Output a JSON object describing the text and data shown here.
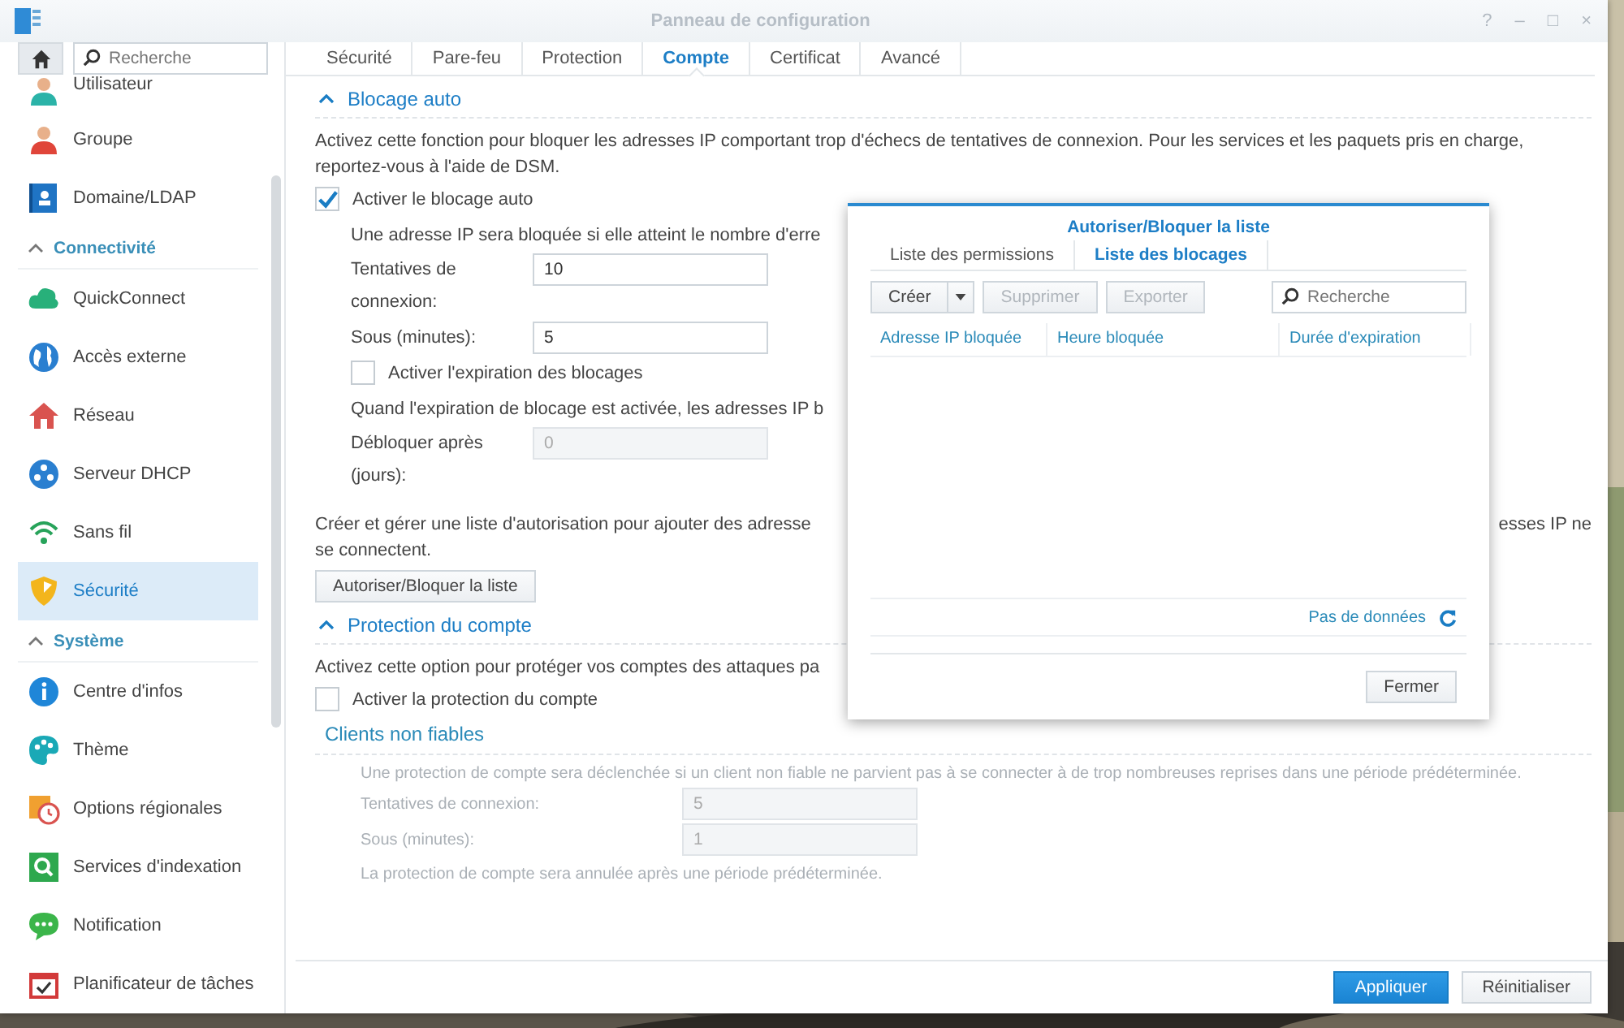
{
  "window": {
    "title": "Panneau de configuration",
    "controls": [
      "?",
      "–",
      "□",
      "×"
    ]
  },
  "sidebar": {
    "search": {
      "placeholder": "Recherche"
    },
    "items": [
      {
        "kind": "item",
        "label": "Utilisateur",
        "selected": false
      },
      {
        "kind": "item",
        "label": "Groupe",
        "selected": false
      },
      {
        "kind": "item",
        "label": "Domaine/LDAP",
        "selected": false
      },
      {
        "kind": "section",
        "label": "Connectivité"
      },
      {
        "kind": "item",
        "label": "QuickConnect",
        "selected": false
      },
      {
        "kind": "item",
        "label": "Accès externe",
        "selected": false
      },
      {
        "kind": "item",
        "label": "Réseau",
        "selected": false
      },
      {
        "kind": "item",
        "label": "Serveur DHCP",
        "selected": false
      },
      {
        "kind": "item",
        "label": "Sans fil",
        "selected": false
      },
      {
        "kind": "item",
        "label": "Sécurité",
        "selected": true
      },
      {
        "kind": "section",
        "label": "Système"
      },
      {
        "kind": "item",
        "label": "Centre d'infos",
        "selected": false
      },
      {
        "kind": "item",
        "label": "Thème",
        "selected": false
      },
      {
        "kind": "item",
        "label": "Options régionales",
        "selected": false
      },
      {
        "kind": "item",
        "label": "Services d'indexation",
        "selected": false
      },
      {
        "kind": "item",
        "label": "Notification",
        "selected": false
      },
      {
        "kind": "item",
        "label": "Planificateur de tâches",
        "selected": false
      }
    ]
  },
  "tabs": [
    {
      "label": "Sécurité",
      "selected": false
    },
    {
      "label": "Pare-feu",
      "selected": false
    },
    {
      "label": "Protection",
      "selected": false
    },
    {
      "label": "Compte",
      "selected": true
    },
    {
      "label": "Certificat",
      "selected": false
    },
    {
      "label": "Avancé",
      "selected": false
    }
  ],
  "auto_block": {
    "title": "Blocage auto",
    "description": "Activez cette fonction pour bloquer les adresses IP comportant trop d'échecs de tentatives de connexion. Pour les services et les paquets pris en charge, reportez-vous à l'aide de DSM.",
    "enable": {
      "label": "Activer le blocage auto",
      "checked": true
    },
    "hint": "Une adresse IP sera bloquée si elle atteint le nombre d'erre",
    "fields": [
      {
        "label": "Tentatives de connexion:",
        "value": "10",
        "disabled": false
      },
      {
        "label": "Sous (minutes):",
        "value": "5",
        "disabled": false
      }
    ],
    "expiration": {
      "label": "Activer l'expiration des blocages",
      "checked": false
    },
    "expiration_hint": "Quand l'expiration de blocage est activée, les adresses IP b",
    "unblock_field": {
      "label": "Débloquer après (jours):",
      "value": "0",
      "disabled": true
    },
    "list_text": {
      "left": "Créer et gérer une liste d'autorisation pour ajouter des adresse",
      "right": "esses IP ne",
      "end": "se connectent."
    },
    "list_button": "Autoriser/Bloquer la liste"
  },
  "account_protection": {
    "title": "Protection du compte",
    "description": "Activez cette option pour protéger vos comptes des attaques pa",
    "enable": {
      "label": "Activer la protection du compte",
      "checked": false
    },
    "subsection": "Clients non fiables",
    "hint": "Une protection de compte sera déclenchée si un client non fiable ne parvient pas à se connecter à de trop nombreuses reprises dans une période prédéterminée.",
    "fields": [
      {
        "label": "Tentatives de connexion:",
        "value": "5",
        "disabled": true
      },
      {
        "label": "Sous (minutes):",
        "value": "1",
        "disabled": true
      }
    ],
    "cancel_hint": "La protection de compte sera annulée après une période prédéterminée."
  },
  "footer": {
    "buttons": [
      {
        "label": "Appliquer",
        "kind": "primary"
      },
      {
        "label": "Réinitialiser",
        "kind": "default"
      }
    ]
  },
  "dialog": {
    "title": "Autoriser/Bloquer la liste",
    "tabs": [
      {
        "label": "Liste des permissions",
        "selected": false
      },
      {
        "label": "Liste des blocages",
        "selected": true
      }
    ],
    "toolbar": [
      {
        "label": "Créer",
        "disabled": false,
        "kind": "split"
      },
      {
        "label": "Supprimer",
        "disabled": true,
        "kind": "button"
      },
      {
        "label": "Exporter",
        "disabled": true,
        "kind": "button"
      }
    ],
    "search": {
      "placeholder": "Recherche"
    },
    "columns": [
      "Adresse IP bloquée",
      "Heure bloquée",
      "Durée d'expiration"
    ],
    "status": "Pas de données",
    "close_button": "Fermer"
  }
}
